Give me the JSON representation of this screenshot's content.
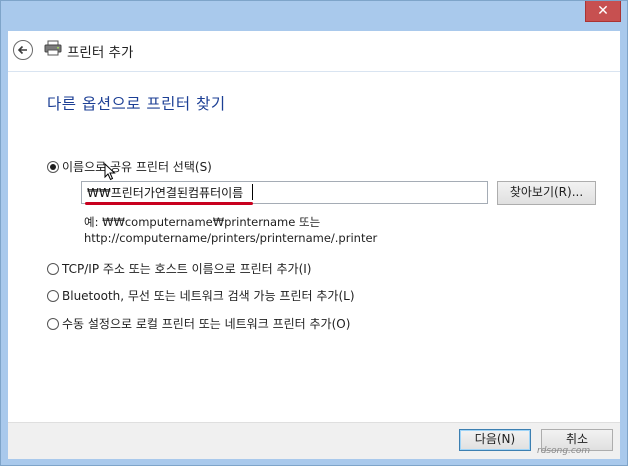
{
  "window": {
    "close_label": "✕"
  },
  "header": {
    "title": "프린터 추가",
    "back_icon": "back-arrow-icon",
    "printer_icon": "printer-icon"
  },
  "page": {
    "heading": "다른 옵션으로 프린터 찾기"
  },
  "options": {
    "by_name": {
      "label": "이름으로 공유 프린터 선택(S)",
      "checked": true
    },
    "tcpip": {
      "label": "TCP/IP 주소 또는 호스트 이름으로 프린터 추가(I)",
      "checked": false
    },
    "bluetooth": {
      "label": "Bluetooth, 무선 또는 네트워크 검색 가능 프린터 추가(L)",
      "checked": false
    },
    "manual": {
      "label": "수동 설정으로 로컬 프린터 또는 네트워크 프린터 추가(O)",
      "checked": false
    }
  },
  "name_input": {
    "value": "₩₩프린터가연결된컴퓨터이름"
  },
  "browse_button": {
    "label": "찾아보기(R)..."
  },
  "example": {
    "line1": "예: ₩₩computername₩printername 또는",
    "line2": "http://computername/printers/printername/.printer"
  },
  "footer": {
    "next_label": "다음(N)",
    "cancel_label": "취소"
  },
  "watermark": {
    "text": "rdsong.com"
  },
  "colors": {
    "title_bar": "#a9c9ec",
    "heading": "#1c3f95",
    "close": "#c75050",
    "annotation": "#c8001e"
  }
}
